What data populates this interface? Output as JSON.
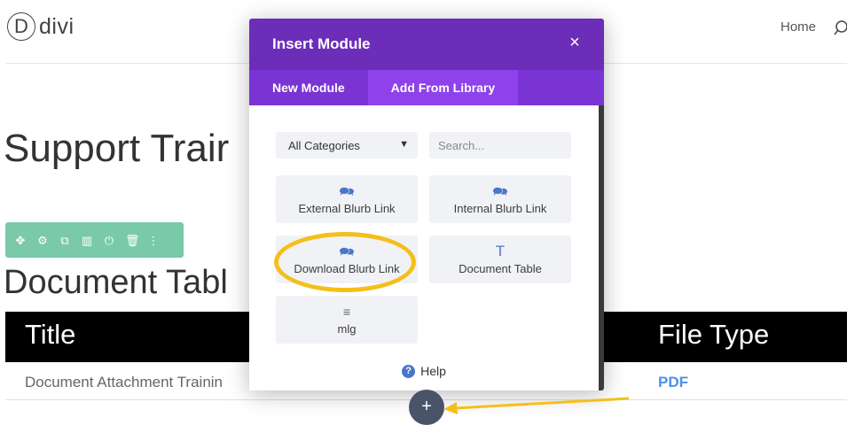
{
  "site": {
    "logo_letter": "D",
    "logo_text": "divi",
    "nav": {
      "home": "Home"
    }
  },
  "page": {
    "title": "Support Trair",
    "section_title": "Document Tabl",
    "row_toolbar_icons": [
      "✥",
      "⚙",
      "⧉",
      "▥",
      "⏻",
      "🗑",
      "⋮"
    ],
    "table": {
      "headers": [
        "Title",
        "File Type"
      ],
      "rows": [
        {
          "title": "Document Attachment Trainin",
          "file_type": "PDF"
        }
      ]
    }
  },
  "modal": {
    "title": "Insert Module",
    "close_icon": "×",
    "tabs": [
      {
        "label": "New Module",
        "active": false
      },
      {
        "label": "Add From Library",
        "active": true
      }
    ],
    "category_select": {
      "value": "All Categories"
    },
    "search": {
      "placeholder": "Search..."
    },
    "modules": [
      {
        "icon": "🗪",
        "label": "External Blurb Link"
      },
      {
        "icon": "🗪",
        "label": "Internal Blurb Link"
      },
      {
        "icon": "🗪",
        "label": "Download Blurb Link",
        "highlighted": true
      },
      {
        "icon": "T",
        "label": "Document Table"
      },
      {
        "icon": "≡",
        "label": "mlg"
      }
    ],
    "help_label": "Help",
    "help_icon": "?"
  },
  "add_button": {
    "icon": "+"
  },
  "colors": {
    "modal_header": "#6c2eb9",
    "tab_bar": "#7b34d4",
    "active_tab": "#8f42ec",
    "row_toolbar": "#7ac9a7",
    "highlight": "#f5bf1a",
    "link_blue": "#4e90e6"
  }
}
